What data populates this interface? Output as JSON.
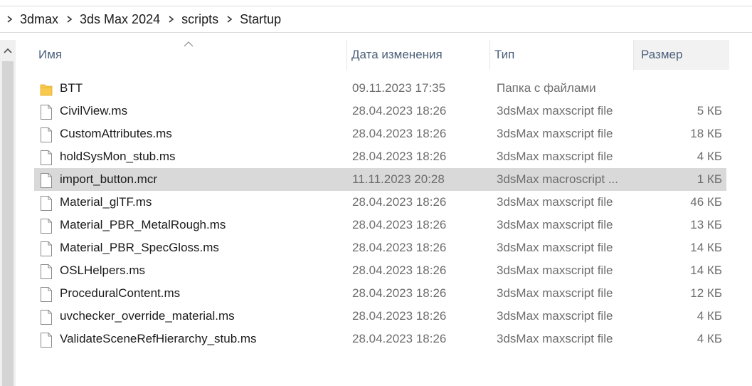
{
  "breadcrumb": [
    "3dmax",
    "3ds Max 2024",
    "scripts",
    "Startup"
  ],
  "columns": {
    "name": "Имя",
    "date": "Дата изменения",
    "type": "Тип",
    "size": "Размер"
  },
  "files": [
    {
      "name": "BTT",
      "date": "09.11.2023 17:35",
      "type": "Папка с файлами",
      "size": "",
      "icon": "folder-icon"
    },
    {
      "name": "CivilView.ms",
      "date": "28.04.2023 18:26",
      "type": "3dsMax maxscript file",
      "size": "5 КБ",
      "icon": "file-icon"
    },
    {
      "name": "CustomAttributes.ms",
      "date": "28.04.2023 18:26",
      "type": "3dsMax maxscript file",
      "size": "18 КБ",
      "icon": "file-icon"
    },
    {
      "name": "holdSysMon_stub.ms",
      "date": "28.04.2023 18:26",
      "type": "3dsMax maxscript file",
      "size": "4 КБ",
      "icon": "file-icon"
    },
    {
      "name": "import_button.mcr",
      "date": "11.11.2023 20:28",
      "type": "3dsMax macroscript ...",
      "size": "1 КБ",
      "icon": "file-icon",
      "selected": true
    },
    {
      "name": "Material_glTF.ms",
      "date": "28.04.2023 18:26",
      "type": "3dsMax maxscript file",
      "size": "46 КБ",
      "icon": "file-icon"
    },
    {
      "name": "Material_PBR_MetalRough.ms",
      "date": "28.04.2023 18:26",
      "type": "3dsMax maxscript file",
      "size": "13 КБ",
      "icon": "file-icon"
    },
    {
      "name": "Material_PBR_SpecGloss.ms",
      "date": "28.04.2023 18:26",
      "type": "3dsMax maxscript file",
      "size": "14 КБ",
      "icon": "file-icon"
    },
    {
      "name": "OSLHelpers.ms",
      "date": "28.04.2023 18:26",
      "type": "3dsMax maxscript file",
      "size": "14 КБ",
      "icon": "file-icon"
    },
    {
      "name": "ProceduralContent.ms",
      "date": "28.04.2023 18:26",
      "type": "3dsMax maxscript file",
      "size": "12 КБ",
      "icon": "file-icon"
    },
    {
      "name": "uvchecker_override_material.ms",
      "date": "28.04.2023 18:26",
      "type": "3dsMax maxscript file",
      "size": "4 КБ",
      "icon": "file-icon"
    },
    {
      "name": "ValidateSceneRefHierarchy_stub.ms",
      "date": "28.04.2023 18:26",
      "type": "3dsMax maxscript file",
      "size": "4 КБ",
      "icon": "file-icon"
    }
  ],
  "colors": {
    "selected_row": "#d9d9d9",
    "header_text": "#4c607a",
    "folder": "#f8c94d"
  }
}
